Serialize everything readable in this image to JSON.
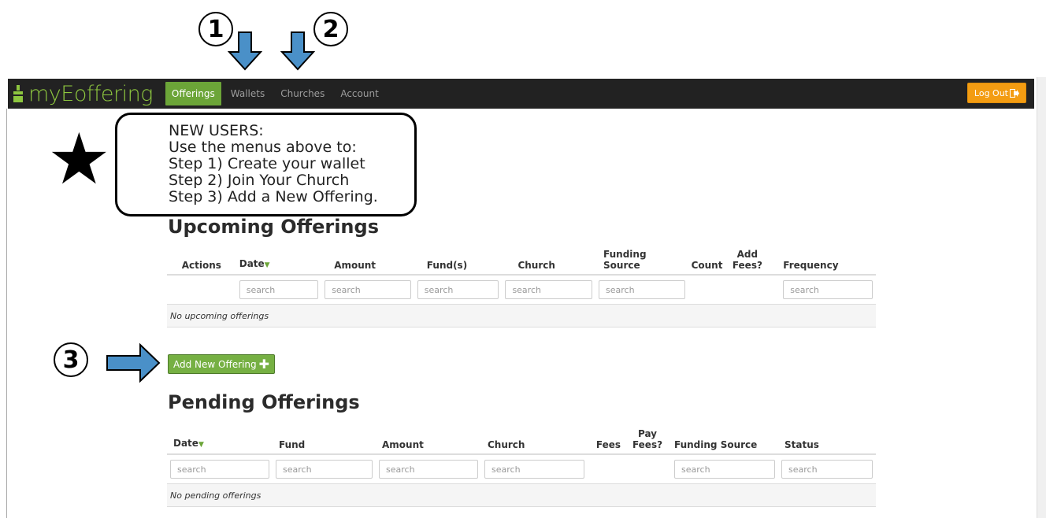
{
  "annotations": {
    "step1": "1",
    "step2": "2",
    "step3": "3",
    "star": "★",
    "arrow_color": "#4a90c8"
  },
  "navbar": {
    "brand": "myEoffering",
    "items": [
      {
        "label": "Offerings",
        "active": true
      },
      {
        "label": "Wallets",
        "active": false
      },
      {
        "label": "Churches",
        "active": false
      },
      {
        "label": "Account",
        "active": false
      }
    ],
    "logout": "Log Out",
    "logout_icon": "logout-icon",
    "accent": "#8dc63f"
  },
  "callout": {
    "line1": "NEW USERS:",
    "line2": "Use the menus above to:",
    "line3": "Step 1) Create your wallet",
    "line4": "Step 2) Join Your Church",
    "line5": "Step 3) Add a New Offering."
  },
  "upcoming": {
    "title": "Upcoming Offerings",
    "columns": [
      "Actions",
      "Date",
      "Amount",
      "Fund(s)",
      "Church",
      "Funding Source",
      "Count",
      "Add Fees?",
      "Frequency"
    ],
    "search_placeholder": "search",
    "empty": "No upcoming offerings"
  },
  "add_button": {
    "label": "Add New Offering",
    "icon": "plus-icon"
  },
  "pending": {
    "title": "Pending Offerings",
    "columns": [
      "Date",
      "Fund",
      "Amount",
      "Church",
      "Fees",
      "Pay Fees?",
      "Funding Source",
      "Status"
    ],
    "search_placeholder": "search",
    "empty": "No pending offerings"
  }
}
